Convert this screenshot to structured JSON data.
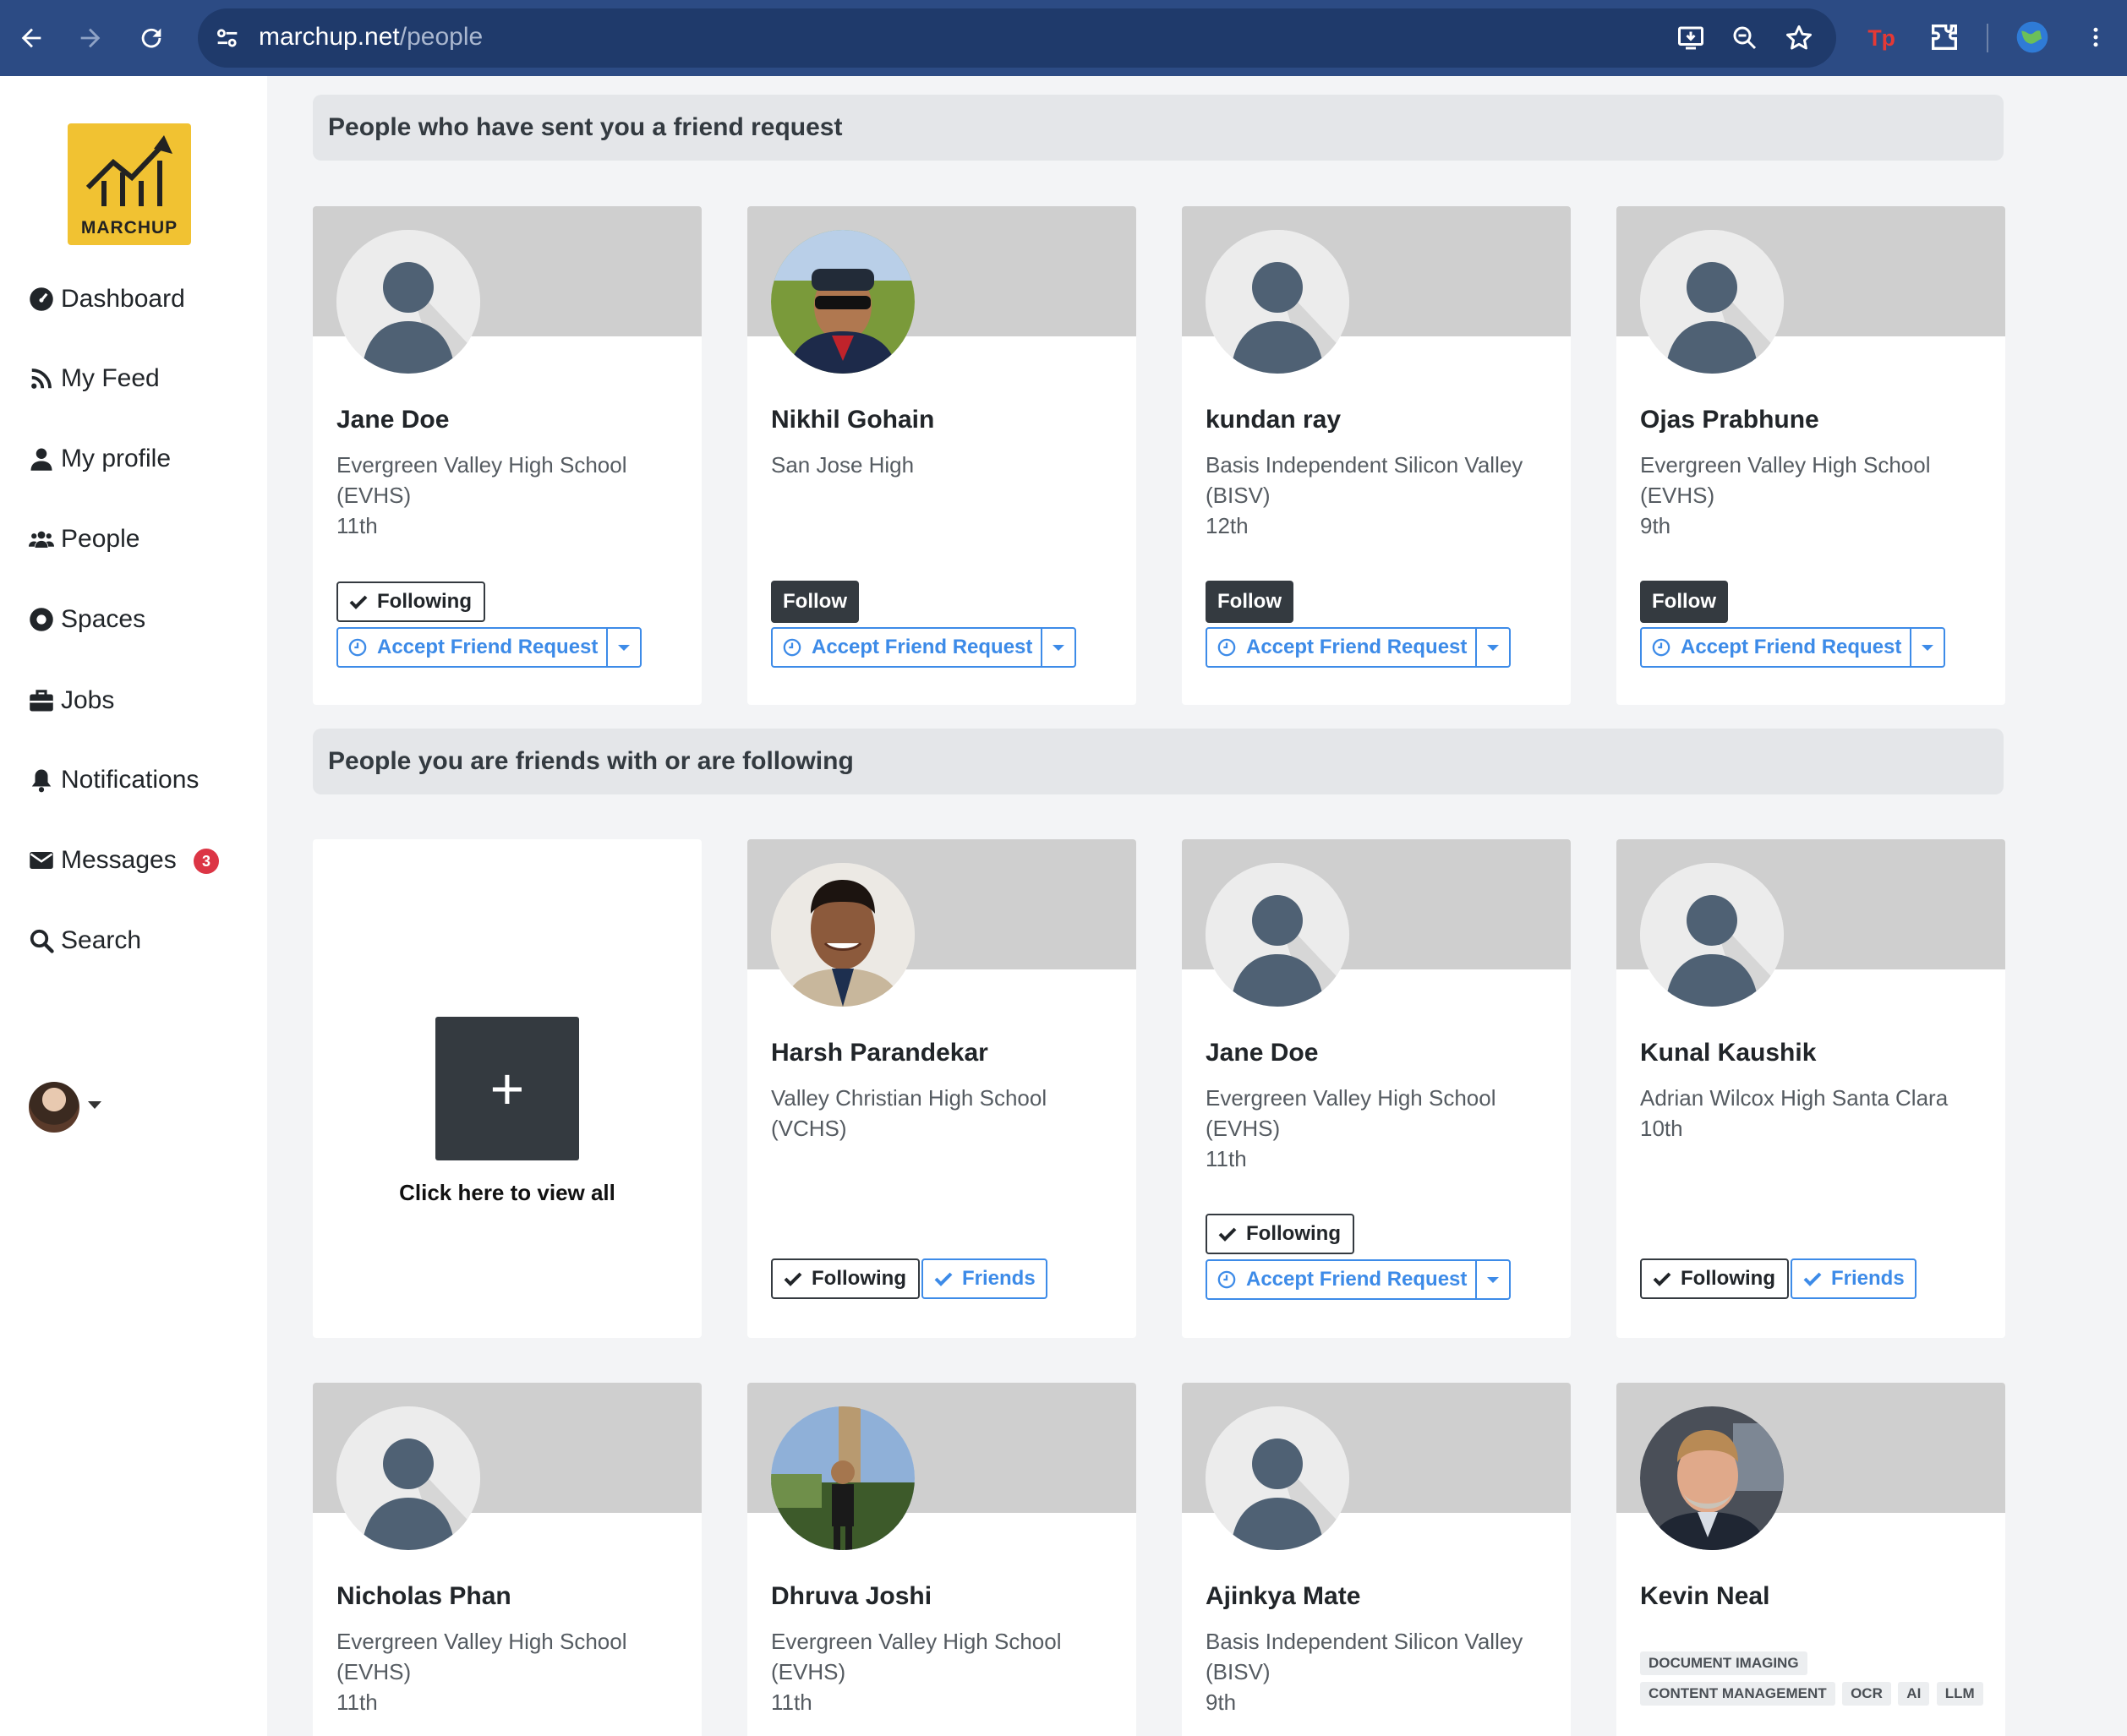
{
  "browser": {
    "url_host": "marchup.net",
    "url_path": "/people"
  },
  "sidebar": {
    "logo_text": "MARCHUP",
    "items": [
      {
        "label": "Dashboard",
        "icon": "dashboard-icon"
      },
      {
        "label": "My Feed",
        "icon": "rss-icon"
      },
      {
        "label": "My profile",
        "icon": "user-icon"
      },
      {
        "label": "People",
        "icon": "users-icon"
      },
      {
        "label": "Spaces",
        "icon": "circle-dot-icon"
      },
      {
        "label": "Jobs",
        "icon": "briefcase-icon"
      },
      {
        "label": "Notifications",
        "icon": "bell-icon"
      },
      {
        "label": "Messages",
        "icon": "envelope-icon"
      },
      {
        "label": "Search",
        "icon": "search-icon"
      }
    ],
    "notification_count": "3"
  },
  "sections": {
    "requests_title": "People who have sent you a friend request",
    "friends_title": "People you are friends with or are following"
  },
  "labels": {
    "following": "Following",
    "follow": "Follow",
    "accept": "Accept Friend Request",
    "friends": "Friends",
    "view_all": "Click here to view all",
    "plus": "+"
  },
  "requests": [
    {
      "name": "Jane Doe",
      "school": "Evergreen Valley High School (EVHS)",
      "grade": "11th",
      "status": "Following"
    },
    {
      "name": "Nikhil Gohain",
      "school": "San Jose High",
      "grade": "",
      "status": "Follow"
    },
    {
      "name": "kundan ray",
      "school": "Basis Independent Silicon Valley (BISV)",
      "grade": "12th",
      "status": "Follow"
    },
    {
      "name": "Ojas Prabhune",
      "school": "Evergreen Valley High School (EVHS)",
      "grade": "9th",
      "status": "Follow"
    }
  ],
  "friends": [
    {
      "name": "Harsh Parandekar",
      "school": "Valley Christian High School (VCHS)",
      "grade": ""
    },
    {
      "name": "Jane Doe",
      "school": "Evergreen Valley High School (EVHS)",
      "grade": "11th"
    },
    {
      "name": "Kunal Kaushik",
      "school": "Adrian Wilcox High Santa Clara",
      "grade": "10th"
    },
    {
      "name": "Nicholas Phan",
      "school": "Evergreen Valley High School (EVHS)",
      "grade": "11th"
    },
    {
      "name": "Dhruva Joshi",
      "school": "Evergreen Valley High School (EVHS)",
      "grade": "11th"
    },
    {
      "name": "Ajinkya Mate",
      "school": "Basis Independent Silicon Valley (BISV)",
      "grade": "9th"
    },
    {
      "name": "Kevin Neal",
      "tags": [
        "DOCUMENT IMAGING",
        "CONTENT MANAGEMENT",
        "OCR",
        "AI",
        "LLM"
      ]
    }
  ],
  "colors": {
    "chrome": "#2c4b84",
    "accent_blue": "#3d8be8",
    "dark_button": "#343a40",
    "badge_red": "#dc3545",
    "logo_yellow": "#f1c232"
  }
}
